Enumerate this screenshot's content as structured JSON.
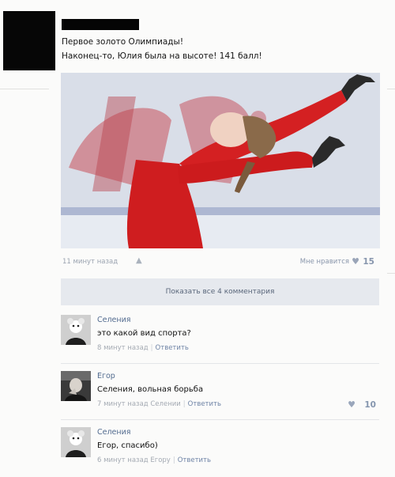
{
  "post": {
    "line1": "Первое золото Олимпиады!",
    "line2": "Наконец-то, Юлия была на высоте! 141 балл!",
    "time": "11 минут назад",
    "like_label": "Мне нравится",
    "like_count": "15"
  },
  "show_all": "Показать все 4 комментария",
  "comments": [
    {
      "name": "Селения",
      "text": "это какой вид спорта?",
      "time": "8 минут назад",
      "reply": "Ответить"
    },
    {
      "name": "Егор",
      "text": "Селения, вольная борьба",
      "time": "7 минут назад Селении",
      "reply": "Ответить",
      "likes": "10"
    },
    {
      "name": "Селения",
      "text": "Егор, спасибо)",
      "time": "6 минут назад Егору",
      "reply": "Ответить"
    }
  ],
  "icons": {
    "android": "android-icon",
    "heart": "heart-icon"
  },
  "colors": {
    "link": "#526b8f",
    "meta": "#a4aab3",
    "costume": "#d41c1c"
  }
}
